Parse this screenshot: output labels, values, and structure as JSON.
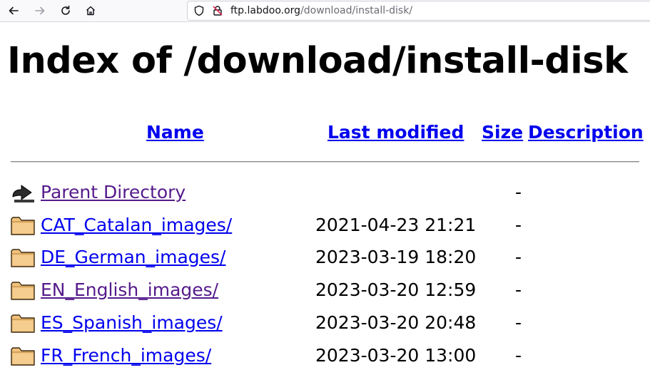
{
  "browser": {
    "url_host": "ftp.labdoo.org",
    "url_path": "/download/install-disk/"
  },
  "page": {
    "title": "Index of /download/install-disk",
    "columns": {
      "name": "Name",
      "last_modified": "Last modified",
      "size": "Size",
      "description": "Description"
    },
    "rows": [
      {
        "icon": "back-arrow-icon",
        "name": "Parent Directory",
        "date": "",
        "size": "-",
        "visited": true
      },
      {
        "icon": "folder-icon",
        "name": "CAT_Catalan_images/",
        "date": "2021-04-23 21:21",
        "size": "-",
        "visited": false
      },
      {
        "icon": "folder-icon",
        "name": "DE_German_images/",
        "date": "2023-03-19 18:20",
        "size": "-",
        "visited": false
      },
      {
        "icon": "folder-icon",
        "name": "EN_English_images/",
        "date": "2023-03-20 12:59",
        "size": "-",
        "visited": true
      },
      {
        "icon": "folder-icon",
        "name": "ES_Spanish_images/",
        "date": "2023-03-20 20:48",
        "size": "-",
        "visited": false
      },
      {
        "icon": "folder-icon",
        "name": "FR_French_images/",
        "date": "2023-03-20 13:00",
        "size": "-",
        "visited": false
      }
    ]
  }
}
